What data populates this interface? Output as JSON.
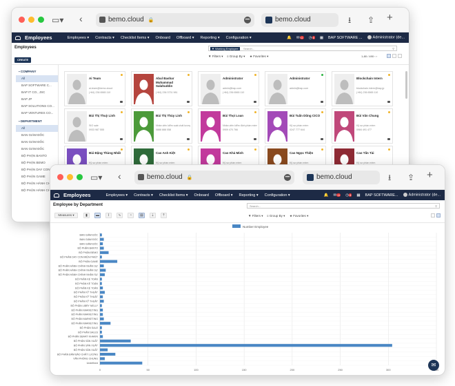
{
  "browser": {
    "url": "bemo.cloud",
    "tab_title": "bemo.cloud",
    "url_lock": "🔒",
    "more": "•••"
  },
  "nav": {
    "app_name": "Employees",
    "menus": [
      "Employees ▾",
      "Contracts ▾",
      "Checklist Items ▾",
      "Onboard",
      "Offboard ▾",
      "Reporting ▾",
      "Configuration ▾"
    ],
    "company": "BAP SOFTWARE ...",
    "company_full": "BAP SOFTWARE...",
    "user": "Administrator (de...",
    "badge_msg": "11",
    "badge_act": "8"
  },
  "kanban_view": {
    "title": "Employees",
    "create": "CREATE",
    "facet": "Working Employee",
    "search_placeholder": "Search...",
    "filters": "Filters",
    "group_by": "Group By",
    "favorites": "Favorites",
    "pager": "1-80 / 490",
    "side": {
      "company_heading": "COMPANY",
      "companies": [
        "All",
        "BAP SOFTWARE C...",
        "BAP IT CO., JSC",
        "BAP JP",
        "BAP SOLUTIONS CO...",
        "BAP VENTURES CO..."
      ],
      "department_heading": "DEPARTMENT",
      "departments": [
        "All",
        "BAN GIÁM ĐỐC",
        "BAN GIÁM ĐỐC",
        "BAN GIÁM ĐỐC",
        "BỘ PHẬN BANTO",
        "BỘ PHẬN BEMO",
        "BỘ PHẬN DAY CON...",
        "BỘ PHẬN GAME",
        "BỘ PHẬN HÀNH CH...",
        "BỘ PHẬN HÀNH CH..."
      ]
    },
    "cards": [
      {
        "name": "Ai Team",
        "job": "ai-team@bemo.cloud",
        "phone": "(+84) 236 6565 110",
        "photo": "none",
        "status": "#f0b429"
      },
      {
        "name": "Abul Bashar Muhammad Salahuddin",
        "job": "",
        "phone": "(+84) 236 3731 981",
        "photo": "red",
        "status": "#f0b429"
      },
      {
        "name": "Administrator",
        "job": "admin@bap.com",
        "phone": "(+84) 236 6565 110",
        "photo": "none",
        "status": "#f0b429"
      },
      {
        "name": "Administrator",
        "job": "admin@bap.com",
        "phone": "",
        "photo": "none",
        "status": "#2fb344"
      },
      {
        "name": "Blockchain Intern",
        "job": "blockchain.intern@bap.jp",
        "phone": "(+84) 236 6565 110",
        "photo": "none",
        "status": "#f0b429"
      },
      {
        "name": "Bùi Thị Thuỳ Linh",
        "job": "SIO sale",
        "phone": "0933 987 555",
        "photo": "none",
        "status": "#f0b429"
      },
      {
        "name": "Bùi Thị Thùy Linh",
        "job": "Nhân viên kiểm soát chất lượng",
        "phone": "0888 888 058",
        "photo": "green",
        "status": "#f0b429"
      },
      {
        "name": "Bùi Thọi Loan",
        "job": "Nhân viên kiểm định phần mềm",
        "phone": "0909 470 766",
        "photo": "magenta",
        "status": "#f0b429"
      },
      {
        "name": "Bùi Tuấn Dũng CICO",
        "job": "Kỹ sư phần mềm",
        "phone": "0247 777 644",
        "photo": "purple",
        "status": "#f0b429"
      },
      {
        "name": "Bùi Văn Chung",
        "job": "Kỹ sư phần mềm",
        "phone": "0984 491 477",
        "photo": "pink",
        "status": "#f0b429"
      },
      {
        "name": "Bùi Đặng Thùng Nhất",
        "job": "Kỹ sư phần mềm",
        "phone": "0984 888 500",
        "photo": "violet",
        "status": "#f0b429"
      },
      {
        "name": "Cao Anh Kiệt",
        "job": "Kỹ sư phần mềm",
        "phone": "anhkiet@...",
        "photo": "darkgreen",
        "status": "#f0b429"
      },
      {
        "name": "Cao Khả Minh",
        "job": "Kỹ sư phần mềm",
        "phone": "0944 560 050",
        "photo": "magenta",
        "status": "#f0b429"
      },
      {
        "name": "Cao Ngọc Thiện",
        "job": "Kỹ sư phần mềm",
        "phone": "0984 580 711",
        "photo": "brown",
        "status": "#f0b429"
      },
      {
        "name": "Cao Tấn Tài",
        "job": "Kỹ sư phần mềm",
        "phone": "0902 123 457",
        "photo": "maroon",
        "status": "#f0b429"
      }
    ]
  },
  "graph_view": {
    "title": "Employee by Department",
    "measures": "Measures ▾",
    "search_placeholder": "Search...",
    "filters": "Filters",
    "group_by": "Group By",
    "favorites": "Favorites"
  },
  "chart_data": {
    "type": "bar",
    "orientation": "horizontal",
    "legend": "Number Employee",
    "legend_position": "top",
    "categories": [
      "BAN GIÁM ĐỐC",
      "BAN GIÁM ĐỐC",
      "BAN GIÁM ĐỐC",
      "BỘ PHẬN BANTO",
      "BỘ PHẬN BEMO",
      "BỘ PHẬN DAY CON MIỆN PHIẾT",
      "BỘ PHẬN GAME",
      "BỘ PHẬN HÀNH CHÍNH NHÂN SỰ",
      "BỘ PHẬN HÀNH CHÍNH NHÂN SỰ",
      "BỘ PHẬN HÀNH CHÍNH NHÂN SỰ",
      "BỘ PHẬN KẾ TOÁN",
      "BỘ PHẬN KẾ TOÁN",
      "BỘ PHẬN KẾ TOÁN",
      "BỘ PHẬN KỸ THUẬT",
      "BỘ PHẬN KỸ THUẬT",
      "BỘ PHẬN KỸ THUẬT",
      "BỘ PHẬN LIBRY NELLY",
      "BỘ PHẬN MARKETING",
      "BỘ PHẬN MARKETING",
      "BỘ PHẬN MARKETING",
      "BỘ PHẬN MARKETING",
      "BỘ PHẬN SALE",
      "BỘ PHẬN SALES",
      "BỘ PHẬN SBART KHAKIN",
      "BỘ PHẬN SẢN XUẤT",
      "BỘ PHẬN SẢN XUẤT",
      "BỘ PHẬN SẢN XUẤT",
      "BỘ PHẬN ĐẢM BẢO CHẤT LƯỢNG",
      "VĂN PHÒNG CHUNG",
      "Undefined"
    ],
    "values": [
      2,
      4,
      3,
      4,
      9,
      2,
      18,
      4,
      6,
      5,
      2,
      2,
      3,
      5,
      3,
      4,
      2,
      3,
      3,
      4,
      11,
      2,
      2,
      3,
      32,
      304,
      8,
      16,
      5,
      44
    ],
    "xlim": [
      0,
      350
    ],
    "xticks": [
      0,
      50,
      100,
      150,
      200,
      250,
      300,
      350
    ],
    "grid": true,
    "color": "#4a87c4"
  }
}
